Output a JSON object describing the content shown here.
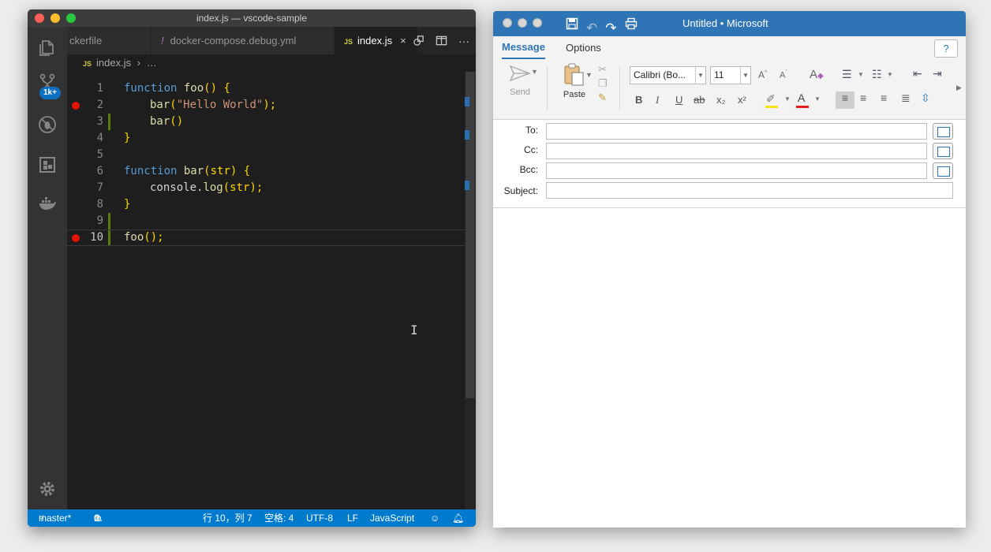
{
  "vscode": {
    "window_title": "index.js — vscode-sample",
    "activity_badge": "1k+",
    "tabs": [
      {
        "label": "ckerfile"
      },
      {
        "icon": "!",
        "label": "docker-compose.debug.yml"
      },
      {
        "icon": "JS",
        "label": "index.js",
        "close": "×"
      }
    ],
    "breadcrumb": {
      "icon": "JS",
      "file": "index.js",
      "sep": "›",
      "more": "…"
    },
    "lines": [
      {
        "num": "1",
        "breakpoint": false,
        "git": false
      },
      {
        "num": "2",
        "breakpoint": true,
        "git": false
      },
      {
        "num": "3",
        "breakpoint": false,
        "git": true
      },
      {
        "num": "4",
        "breakpoint": false,
        "git": false
      },
      {
        "num": "5",
        "breakpoint": false,
        "git": false
      },
      {
        "num": "6",
        "breakpoint": false,
        "git": false
      },
      {
        "num": "7",
        "breakpoint": false,
        "git": false
      },
      {
        "num": "8",
        "breakpoint": false,
        "git": false
      },
      {
        "num": "9",
        "breakpoint": false,
        "git": true
      },
      {
        "num": "10",
        "breakpoint": true,
        "git": true
      }
    ],
    "code": {
      "l1": [
        "function",
        " ",
        "foo",
        "() {"
      ],
      "l2": [
        "bar",
        "(",
        "\"Hello World\"",
        ");"
      ],
      "l3": [
        "bar",
        "()"
      ],
      "l4": [
        "}"
      ],
      "l6": [
        "function",
        " ",
        "bar",
        "(str) {"
      ],
      "l7": [
        "console.",
        "log",
        "(str);"
      ],
      "l8": [
        "}"
      ],
      "l10": [
        "foo",
        "();"
      ]
    },
    "status": {
      "branch": "master*",
      "errors": "0",
      "warnings": "0",
      "position": "行 10，列 7",
      "indent": "空格: 4",
      "encoding": "UTF-8",
      "eol": "LF",
      "language": "JavaScript"
    }
  },
  "outlook": {
    "title": "Untitled • Microsoft",
    "tabs": {
      "message": "Message",
      "options": "Options"
    },
    "help": "?",
    "ribbon": {
      "send": "Send",
      "paste": "Paste",
      "font_name": "Calibri (Bo...",
      "font_size": "11",
      "format": {
        "bold": "B",
        "italic": "I",
        "underline": "U",
        "strike": "ab",
        "subscript": "x₂",
        "superscript": "x²"
      }
    },
    "fields": {
      "to": "To:",
      "cc": "Cc:",
      "bcc": "Bcc:",
      "subject": "Subject:",
      "to_value": "",
      "cc_value": "",
      "bcc_value": "",
      "subject_value": ""
    }
  },
  "colors": {
    "vscode_status": "#007acc",
    "outlook_title": "#2f75b5",
    "breakpoint": "#e51400",
    "git_added": "#587c0c"
  }
}
